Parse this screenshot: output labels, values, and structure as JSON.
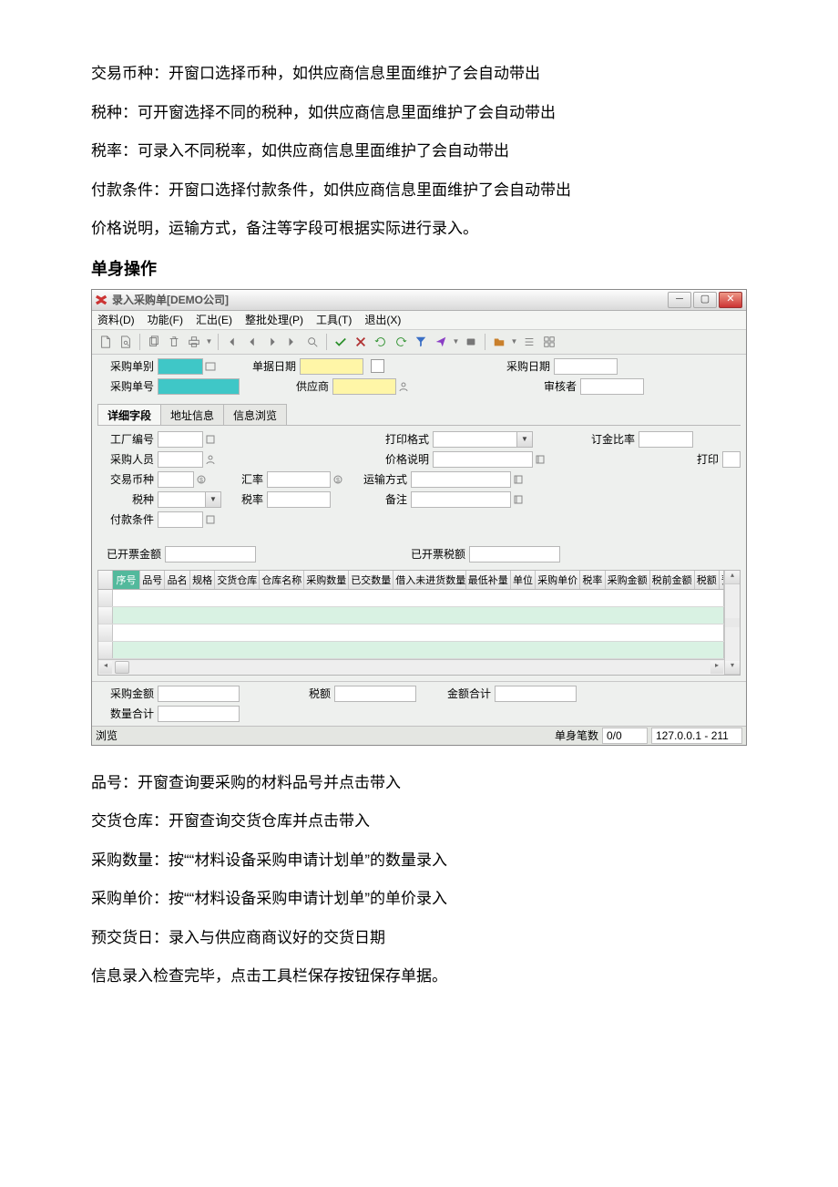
{
  "intro": {
    "p1": "交易币种：开窗口选择币种，如供应商信息里面维护了会自动带出",
    "p2": "税种：可开窗选择不同的税种，如供应商信息里面维护了会自动带出",
    "p3": "税率：可录入不同税率，如供应商信息里面维护了会自动带出",
    "p4": "付款条件：开窗口选择付款条件，如供应商信息里面维护了会自动带出",
    "p5": "价格说明，运输方式，备注等字段可根据实际进行录入。",
    "heading": "单身操作"
  },
  "app": {
    "title": "录入采购单[DEMO公司]",
    "menu": {
      "data": "资料(D)",
      "func": "功能(F)",
      "export": "汇出(E)",
      "batch": "整批处理(P)",
      "tool": "工具(T)",
      "exit": "退出(X)"
    }
  },
  "form": {
    "order_type": "采购单别",
    "doc_date": "单据日期",
    "purchase_date": "采购日期",
    "order_no": "采购单号",
    "supplier": "供应商",
    "auditor": "审核者",
    "tabs": {
      "detail": "详细字段",
      "addr": "地址信息",
      "browse": "信息浏览"
    },
    "factory_no": "工厂编号",
    "print_format": "打印格式",
    "deposit_ratio": "订金比率",
    "purchaser": "采购人员",
    "price_desc": "价格说明",
    "print": "打印",
    "currency": "交易币种",
    "rate": "汇率",
    "ship_method": "运输方式",
    "tax_type": "税种",
    "tax_rate": "税率",
    "remark": "备注",
    "pay_cond": "付款条件",
    "invoiced_amt": "已开票金额",
    "invoiced_tax": "已开票税额"
  },
  "grid": {
    "cols": [
      "序号",
      "品号",
      "品名",
      "规格",
      "交货仓库",
      "仓库名称",
      "采购数量",
      "已交数量",
      "借入未进货数量",
      "最低补量",
      "单位",
      "采购单价",
      "税率",
      "采购金额",
      "税前金额",
      "税额",
      "预"
    ]
  },
  "totals": {
    "purchase_amt": "采购金额",
    "tax_amt": "税额",
    "total_amt": "金额合计",
    "qty_total": "数量合计"
  },
  "status": {
    "mode": "浏览",
    "rows_label": "单身笔数",
    "rows_value": "0/0",
    "server": "127.0.0.1 - 211"
  },
  "outro": {
    "p1": "品号：开窗查询要采购的材料品号并点击带入",
    "p2": "交货仓库：开窗查询交货仓库并点击带入",
    "p3": "采购数量：按““材料设备采购申请计划单”的数量录入",
    "p4": "采购单价：按““材料设备采购申请计划单”的单价录入",
    "p5": "预交货日：录入与供应商商议好的交货日期",
    "p6": "信息录入检查完毕，点击工具栏保存按钮保存单据。"
  }
}
